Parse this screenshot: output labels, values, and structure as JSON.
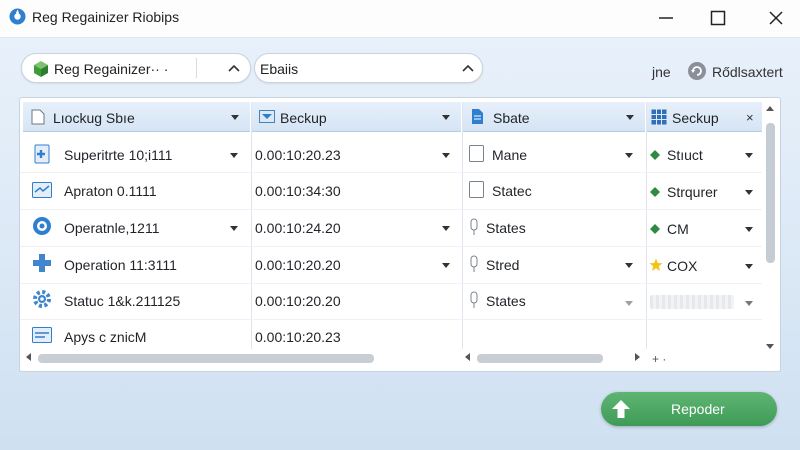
{
  "window": {
    "title": "Reg Regainizer Riobips",
    "controls": [
      "minimize",
      "maximize",
      "close"
    ]
  },
  "toolbar": {
    "combo1": {
      "value": "Reg Regainizer·· ·"
    },
    "combo2": {
      "value": "Ebaiis"
    },
    "link_label": "jne",
    "reload_label": "Rődlsaxtert"
  },
  "grid": {
    "columns": [
      {
        "label": "Lıockug Sbıe",
        "icon": "document-icon"
      },
      {
        "label": "Beckup",
        "icon": "image-icon"
      },
      {
        "label": "Sbate",
        "icon": "file-icon"
      },
      {
        "label": "Seckup",
        "icon": "grid-icon",
        "closable": true
      }
    ],
    "rows": [
      {
        "name": "Superitrte 10;i111",
        "icon": "plus-doc-icon",
        "backup": "0.00:10:20.23",
        "state": "Mane",
        "state_icon": "checkbox-icon",
        "setup": "Stıuct",
        "setup_icon": "diamond-icon"
      },
      {
        "name": "Apraton 0.1111",
        "icon": "card-icon",
        "backup": "0.00:10:34:30",
        "state": "Statec",
        "state_icon": "checkbox-icon",
        "setup": "Strqurer",
        "setup_icon": "diamond-icon"
      },
      {
        "name": "Operatnle,1211",
        "icon": "gear-blue-icon",
        "backup": "0.00:10:24.20",
        "state": "States",
        "state_icon": "pin-icon",
        "setup": "CM",
        "setup_icon": "diamond-icon"
      },
      {
        "name": "Operation 11:3111",
        "icon": "plus-icon",
        "backup": "0.00:10:20.20",
        "state": "Stred",
        "state_icon": "pin-icon",
        "setup": "COX",
        "setup_icon": "star-icon"
      },
      {
        "name": "Statuc 1&k.211125",
        "icon": "gear-icon",
        "backup": "0.00:10:20.20",
        "state": "States",
        "state_icon": "pin-icon",
        "setup": "",
        "setup_icon": ""
      },
      {
        "name": "Apys c znicM",
        "icon": "card-icon",
        "backup": "0.00:10:20.23",
        "state": "",
        "state_icon": "",
        "setup": "",
        "setup_icon": ""
      }
    ],
    "footer_marks": "+ ·"
  },
  "actions": {
    "reorder_label": "Repoder"
  },
  "colors": {
    "accent_green": "#3e9b56",
    "header_blue": "#d5e4f4",
    "icon_blue": "#2f7fcf",
    "diamond_green": "#2e8b43",
    "star_yellow": "#f2c318"
  }
}
